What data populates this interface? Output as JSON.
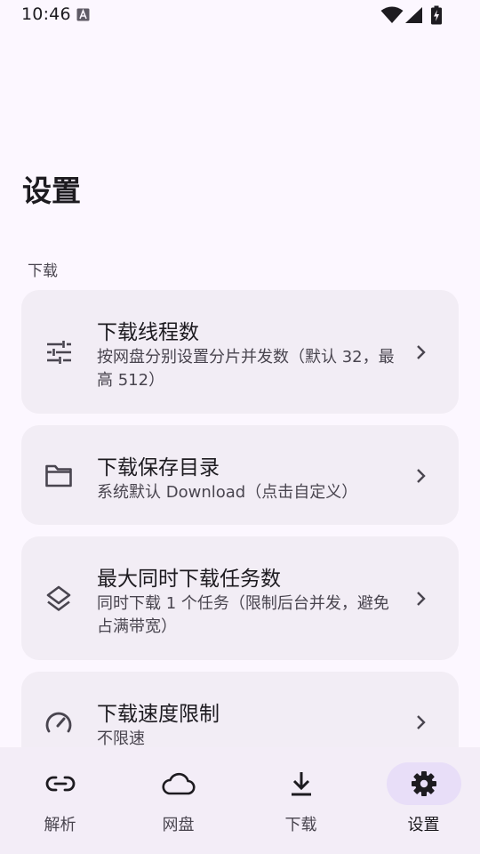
{
  "status_bar": {
    "time": "10:46",
    "icons": [
      "a-notification-icon",
      "wifi-icon",
      "signal-icon",
      "battery-charging-icon"
    ]
  },
  "page": {
    "title": "设置"
  },
  "sections": [
    {
      "header": "下载",
      "items": [
        {
          "icon": "tune-sliders-icon",
          "title": "下载线程数",
          "subtitle": "按网盘分别设置分片并发数（默认 32，最高 512）"
        },
        {
          "icon": "folder-icon",
          "title": "下载保存目录",
          "subtitle": "系统默认 Download（点击自定义）"
        },
        {
          "icon": "layers-icon",
          "title": "最大同时下载任务数",
          "subtitle": "同时下载 1 个任务（限制后台并发，避免占满带宽）"
        },
        {
          "icon": "speedometer-icon",
          "title": "下载速度限制",
          "subtitle": "不限速"
        }
      ]
    }
  ],
  "bottom_nav": {
    "items": [
      {
        "label": "解析",
        "icon": "link-icon",
        "active": false
      },
      {
        "label": "网盘",
        "icon": "cloud-icon",
        "active": false
      },
      {
        "label": "下载",
        "icon": "download-icon",
        "active": false
      },
      {
        "label": "设置",
        "icon": "gear-icon",
        "active": true
      }
    ]
  },
  "colors": {
    "background": "#FCF7FF",
    "card": "#F2EDF5",
    "nav_background": "#F3EDF7",
    "active_indicator": "#E8DEF8",
    "text_primary": "#1D1B20",
    "text_secondary": "#49454F"
  }
}
